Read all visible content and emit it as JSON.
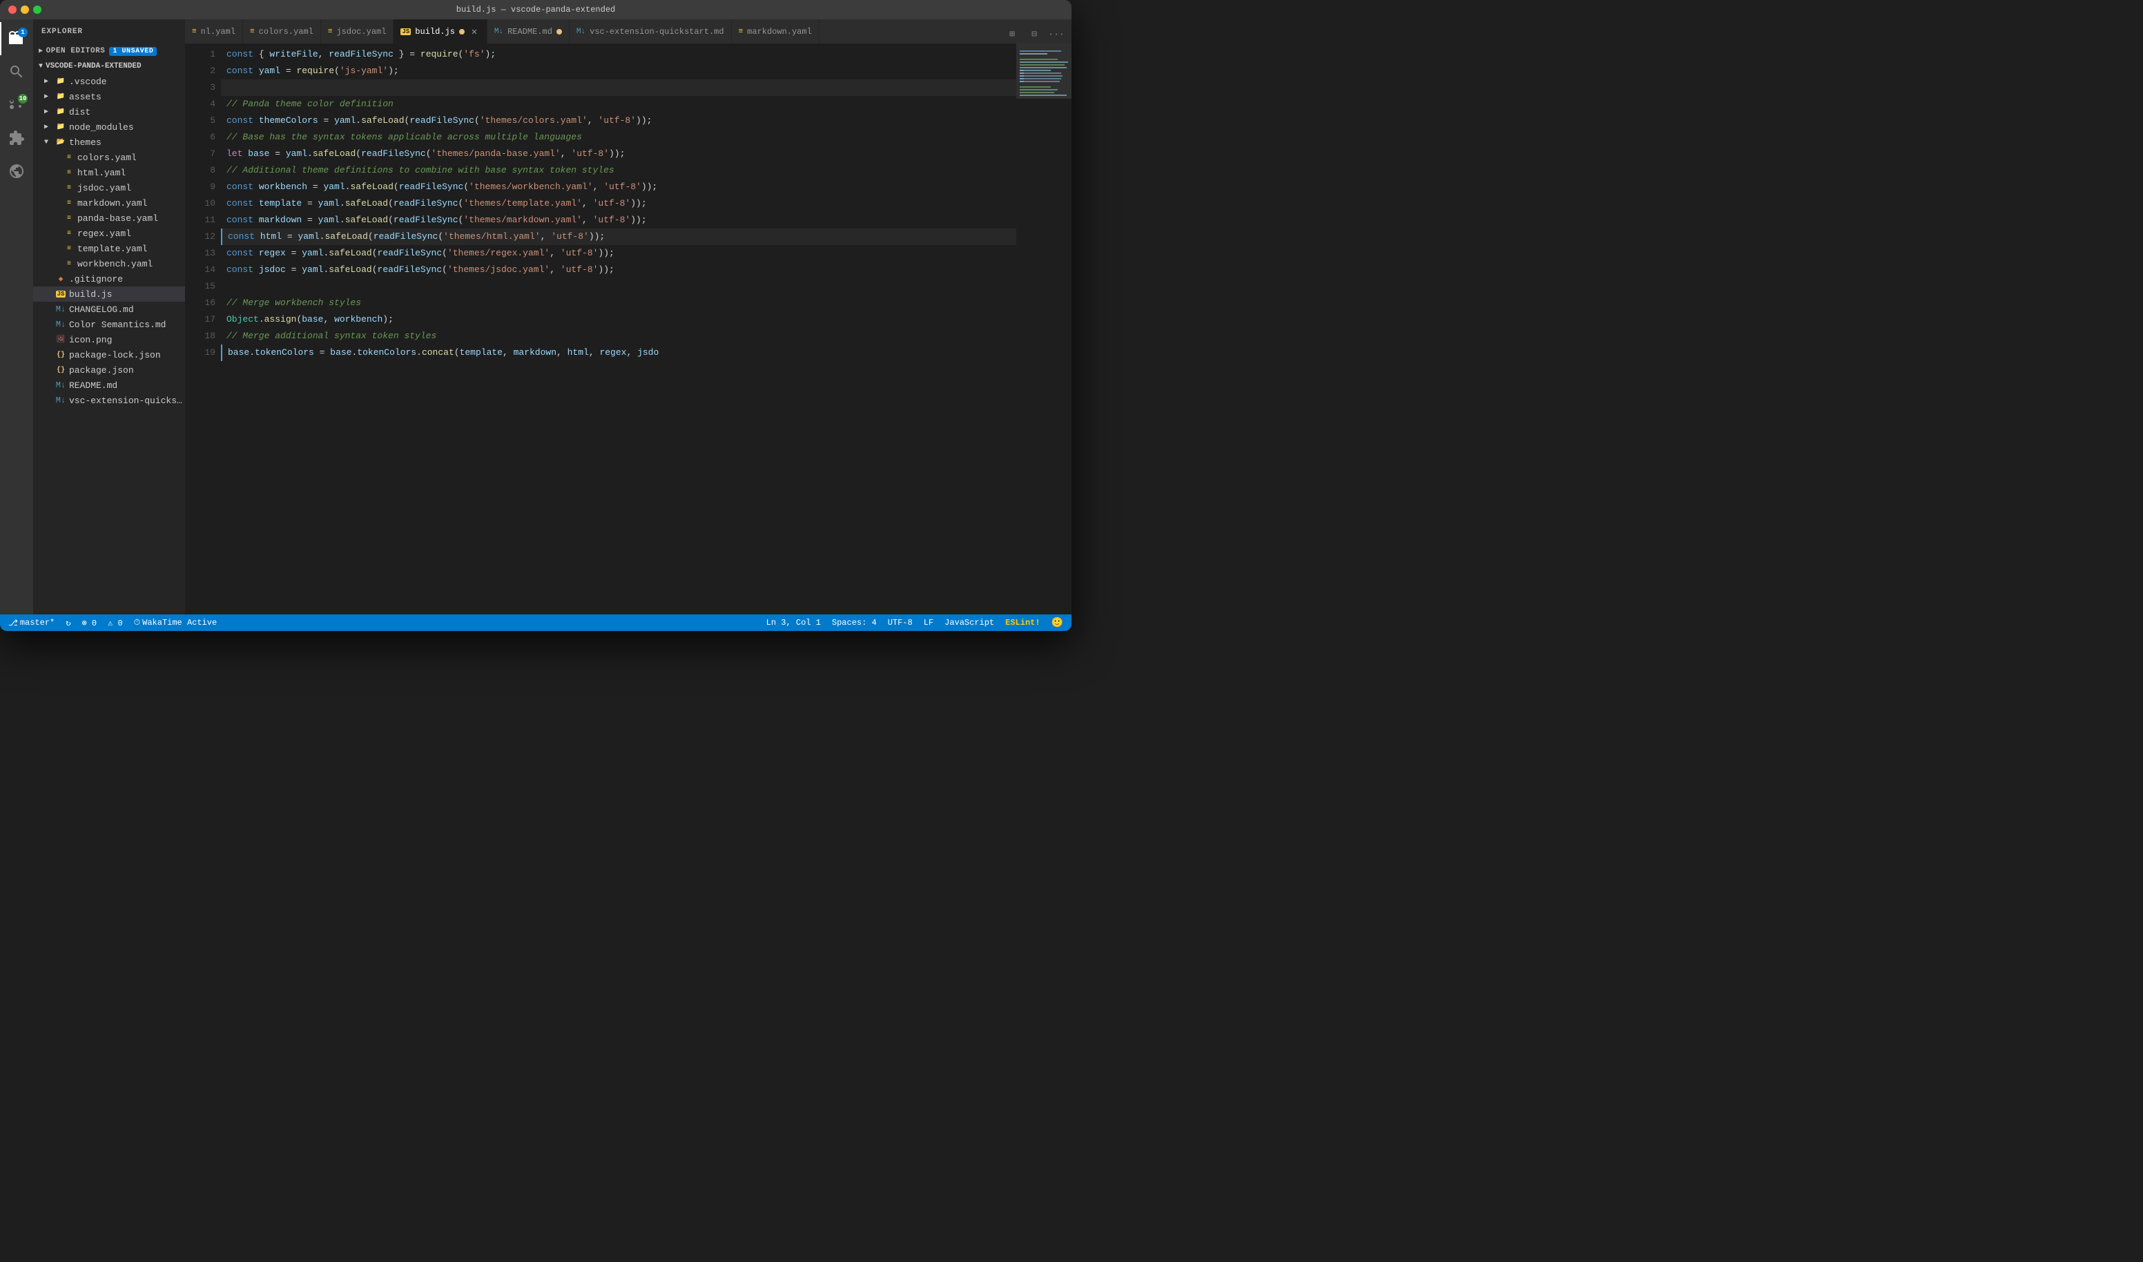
{
  "window": {
    "title": "build.js — vscode-panda-extended"
  },
  "titlebar": {
    "traffic_lights": [
      "close",
      "minimize",
      "maximize"
    ]
  },
  "activity_bar": {
    "icons": [
      {
        "name": "explorer",
        "active": true,
        "badge": "1"
      },
      {
        "name": "search",
        "active": false
      },
      {
        "name": "source-control",
        "active": false,
        "badge": "10"
      },
      {
        "name": "extensions",
        "active": false
      },
      {
        "name": "remote",
        "active": false
      }
    ]
  },
  "sidebar": {
    "header": "Explorer",
    "sections": [
      {
        "label": "Open Editors",
        "badge": "1 Unsaved",
        "collapsed": false
      },
      {
        "label": "VSCODE-PANDA-EXTENDED",
        "collapsed": false
      }
    ],
    "tree": [
      {
        "label": ".vscode",
        "type": "folder",
        "indent": 1,
        "collapsed": true
      },
      {
        "label": "assets",
        "type": "folder",
        "indent": 1,
        "collapsed": true
      },
      {
        "label": "dist",
        "type": "folder",
        "indent": 1,
        "collapsed": true
      },
      {
        "label": "node_modules",
        "type": "folder",
        "indent": 1,
        "collapsed": true
      },
      {
        "label": "themes",
        "type": "folder-open",
        "indent": 1,
        "collapsed": false
      },
      {
        "label": "colors.yaml",
        "type": "yaml",
        "indent": 2
      },
      {
        "label": "html.yaml",
        "type": "yaml",
        "indent": 2
      },
      {
        "label": "jsdoc.yaml",
        "type": "yaml",
        "indent": 2
      },
      {
        "label": "markdown.yaml",
        "type": "yaml",
        "indent": 2
      },
      {
        "label": "panda-base.yaml",
        "type": "yaml",
        "indent": 2
      },
      {
        "label": "regex.yaml",
        "type": "yaml",
        "indent": 2
      },
      {
        "label": "template.yaml",
        "type": "yaml",
        "indent": 2
      },
      {
        "label": "workbench.yaml",
        "type": "yaml",
        "indent": 2
      },
      {
        "label": ".gitignore",
        "type": "git",
        "indent": 1
      },
      {
        "label": "build.js",
        "type": "js",
        "indent": 1,
        "active": true
      },
      {
        "label": "CHANGELOG.md",
        "type": "md",
        "indent": 1
      },
      {
        "label": "Color Semantics.md",
        "type": "md",
        "indent": 1
      },
      {
        "label": "icon.png",
        "type": "png",
        "indent": 1
      },
      {
        "label": "package-lock.json",
        "type": "json",
        "indent": 1
      },
      {
        "label": "package.json",
        "type": "json",
        "indent": 1
      },
      {
        "label": "README.md",
        "type": "md",
        "indent": 1
      },
      {
        "label": "vsc-extension-quickstart.md",
        "type": "md",
        "indent": 1
      }
    ]
  },
  "tabs": [
    {
      "label": "nl.yaml",
      "type": "yaml",
      "active": false,
      "modified": false
    },
    {
      "label": "colors.yaml",
      "type": "yaml",
      "active": false,
      "modified": false
    },
    {
      "label": "jsdoc.yaml",
      "type": "yaml",
      "active": false,
      "modified": false
    },
    {
      "label": "build.js",
      "type": "js",
      "active": true,
      "modified": true
    },
    {
      "label": "README.md",
      "type": "md",
      "active": false,
      "modified": true
    },
    {
      "label": "vsc-extension-quickstart.md",
      "type": "md",
      "active": false,
      "modified": false
    },
    {
      "label": "markdown.yaml",
      "type": "yaml",
      "active": false,
      "modified": false
    }
  ],
  "code_lines": [
    {
      "num": 1,
      "tokens": [
        {
          "t": "kw",
          "v": "const"
        },
        {
          "t": "op",
          "v": " { "
        },
        {
          "t": "var",
          "v": "writeFile"
        },
        {
          "t": "op",
          "v": ", "
        },
        {
          "t": "var",
          "v": "readFileSync"
        },
        {
          "t": "op",
          "v": " } = "
        },
        {
          "t": "fn",
          "v": "require"
        },
        {
          "t": "op",
          "v": "("
        },
        {
          "t": "str",
          "v": "'fs'"
        },
        {
          "t": "op",
          "v": ");"
        }
      ]
    },
    {
      "num": 2,
      "tokens": [
        {
          "t": "kw",
          "v": "const"
        },
        {
          "t": "op",
          "v": " "
        },
        {
          "t": "var",
          "v": "yaml"
        },
        {
          "t": "op",
          "v": " = "
        },
        {
          "t": "fn",
          "v": "require"
        },
        {
          "t": "op",
          "v": "("
        },
        {
          "t": "str",
          "v": "'js-yaml'"
        },
        {
          "t": "op",
          "v": ");"
        }
      ]
    },
    {
      "num": 3,
      "tokens": []
    },
    {
      "num": 4,
      "tokens": [
        {
          "t": "cm",
          "v": "// Panda theme color definition"
        }
      ]
    },
    {
      "num": 5,
      "tokens": [
        {
          "t": "kw",
          "v": "const"
        },
        {
          "t": "op",
          "v": " "
        },
        {
          "t": "var",
          "v": "themeColors"
        },
        {
          "t": "op",
          "v": " = "
        },
        {
          "t": "var",
          "v": "yaml"
        },
        {
          "t": "op",
          "v": "."
        },
        {
          "t": "fn",
          "v": "safeLoad"
        },
        {
          "t": "op",
          "v": "("
        },
        {
          "t": "var",
          "v": "readFileSync"
        },
        {
          "t": "op",
          "v": "("
        },
        {
          "t": "str",
          "v": "'themes/colors.yaml'"
        },
        {
          "t": "op",
          "v": ", "
        },
        {
          "t": "str",
          "v": "'utf-8'"
        },
        {
          "t": "op",
          "v": "));"
        }
      ]
    },
    {
      "num": 6,
      "tokens": [
        {
          "t": "cm",
          "v": "// Base has the syntax tokens applicable across multiple languages"
        }
      ]
    },
    {
      "num": 7,
      "tokens": [
        {
          "t": "kw2",
          "v": "let"
        },
        {
          "t": "op",
          "v": " "
        },
        {
          "t": "var",
          "v": "base"
        },
        {
          "t": "op",
          "v": " = "
        },
        {
          "t": "var",
          "v": "yaml"
        },
        {
          "t": "op",
          "v": "."
        },
        {
          "t": "fn",
          "v": "safeLoad"
        },
        {
          "t": "op",
          "v": "("
        },
        {
          "t": "var",
          "v": "readFileSync"
        },
        {
          "t": "op",
          "v": "("
        },
        {
          "t": "str",
          "v": "'themes/panda-base.yaml'"
        },
        {
          "t": "op",
          "v": ", "
        },
        {
          "t": "str",
          "v": "'utf-8'"
        },
        {
          "t": "op",
          "v": "));"
        }
      ]
    },
    {
      "num": 8,
      "tokens": [
        {
          "t": "cm",
          "v": "// Additional theme definitions to combine with base syntax token styles"
        }
      ]
    },
    {
      "num": 9,
      "tokens": [
        {
          "t": "kw",
          "v": "const"
        },
        {
          "t": "op",
          "v": " "
        },
        {
          "t": "var",
          "v": "workbench"
        },
        {
          "t": "op",
          "v": " = "
        },
        {
          "t": "var",
          "v": "yaml"
        },
        {
          "t": "op",
          "v": "."
        },
        {
          "t": "fn",
          "v": "safeLoad"
        },
        {
          "t": "op",
          "v": "("
        },
        {
          "t": "var",
          "v": "readFileSync"
        },
        {
          "t": "op",
          "v": "("
        },
        {
          "t": "str",
          "v": "'themes/workbench.yaml'"
        },
        {
          "t": "op",
          "v": ", "
        },
        {
          "t": "str",
          "v": "'utf-8'"
        },
        {
          "t": "op",
          "v": "));"
        }
      ]
    },
    {
      "num": 10,
      "tokens": [
        {
          "t": "kw",
          "v": "const"
        },
        {
          "t": "op",
          "v": " "
        },
        {
          "t": "var",
          "v": "template"
        },
        {
          "t": "op",
          "v": " = "
        },
        {
          "t": "var",
          "v": "yaml"
        },
        {
          "t": "op",
          "v": "."
        },
        {
          "t": "fn",
          "v": "safeLoad"
        },
        {
          "t": "op",
          "v": "("
        },
        {
          "t": "var",
          "v": "readFileSync"
        },
        {
          "t": "op",
          "v": "("
        },
        {
          "t": "str",
          "v": "'themes/template.yaml'"
        },
        {
          "t": "op",
          "v": ", "
        },
        {
          "t": "str",
          "v": "'utf-8'"
        },
        {
          "t": "op",
          "v": "));"
        }
      ]
    },
    {
      "num": 11,
      "tokens": [
        {
          "t": "kw",
          "v": "const"
        },
        {
          "t": "op",
          "v": " "
        },
        {
          "t": "var",
          "v": "markdown"
        },
        {
          "t": "op",
          "v": " = "
        },
        {
          "t": "var",
          "v": "yaml"
        },
        {
          "t": "op",
          "v": "."
        },
        {
          "t": "fn",
          "v": "safeLoad"
        },
        {
          "t": "op",
          "v": "("
        },
        {
          "t": "var",
          "v": "readFileSync"
        },
        {
          "t": "op",
          "v": "("
        },
        {
          "t": "str",
          "v": "'themes/markdown.yaml'"
        },
        {
          "t": "op",
          "v": ", "
        },
        {
          "t": "str",
          "v": "'utf-8'"
        },
        {
          "t": "op",
          "v": "));"
        }
      ]
    },
    {
      "num": 12,
      "current": true,
      "tokens": [
        {
          "t": "kw",
          "v": "const"
        },
        {
          "t": "op",
          "v": " "
        },
        {
          "t": "var",
          "v": "html"
        },
        {
          "t": "op",
          "v": " = "
        },
        {
          "t": "var",
          "v": "yaml"
        },
        {
          "t": "op",
          "v": "."
        },
        {
          "t": "fn",
          "v": "safeLoad"
        },
        {
          "t": "op",
          "v": "("
        },
        {
          "t": "var",
          "v": "readFileSync"
        },
        {
          "t": "op",
          "v": "("
        },
        {
          "t": "str",
          "v": "'themes/html.yaml'"
        },
        {
          "t": "op",
          "v": ", "
        },
        {
          "t": "str",
          "v": "'utf-8'"
        },
        {
          "t": "op",
          "v": "));"
        }
      ]
    },
    {
      "num": 13,
      "tokens": [
        {
          "t": "kw",
          "v": "const"
        },
        {
          "t": "op",
          "v": " "
        },
        {
          "t": "var",
          "v": "regex"
        },
        {
          "t": "op",
          "v": " = "
        },
        {
          "t": "var",
          "v": "yaml"
        },
        {
          "t": "op",
          "v": "."
        },
        {
          "t": "fn",
          "v": "safeLoad"
        },
        {
          "t": "op",
          "v": "("
        },
        {
          "t": "var",
          "v": "readFileSync"
        },
        {
          "t": "op",
          "v": "("
        },
        {
          "t": "str",
          "v": "'themes/regex.yaml'"
        },
        {
          "t": "op",
          "v": ", "
        },
        {
          "t": "str",
          "v": "'utf-8'"
        },
        {
          "t": "op",
          "v": "));"
        }
      ]
    },
    {
      "num": 14,
      "tokens": [
        {
          "t": "kw",
          "v": "const"
        },
        {
          "t": "op",
          "v": " "
        },
        {
          "t": "var",
          "v": "jsdoc"
        },
        {
          "t": "op",
          "v": " = "
        },
        {
          "t": "var",
          "v": "yaml"
        },
        {
          "t": "op",
          "v": "."
        },
        {
          "t": "fn",
          "v": "safeLoad"
        },
        {
          "t": "op",
          "v": "("
        },
        {
          "t": "var",
          "v": "readFileSync"
        },
        {
          "t": "op",
          "v": "("
        },
        {
          "t": "str",
          "v": "'themes/jsdoc.yaml'"
        },
        {
          "t": "op",
          "v": ", "
        },
        {
          "t": "str",
          "v": "'utf-8'"
        },
        {
          "t": "op",
          "v": "));"
        }
      ]
    },
    {
      "num": 15,
      "tokens": []
    },
    {
      "num": 16,
      "tokens": [
        {
          "t": "cm",
          "v": "// Merge workbench styles"
        }
      ]
    },
    {
      "num": 17,
      "tokens": [
        {
          "t": "obj",
          "v": "Object"
        },
        {
          "t": "op",
          "v": "."
        },
        {
          "t": "fn",
          "v": "assign"
        },
        {
          "t": "op",
          "v": "("
        },
        {
          "t": "var",
          "v": "base"
        },
        {
          "t": "op",
          "v": ", "
        },
        {
          "t": "var",
          "v": "workbench"
        },
        {
          "t": "op",
          "v": ");"
        }
      ]
    },
    {
      "num": 18,
      "tokens": [
        {
          "t": "cm",
          "v": "// Merge additional syntax token styles"
        }
      ]
    },
    {
      "num": 19,
      "current_line_indicator": true,
      "tokens": [
        {
          "t": "var",
          "v": "base"
        },
        {
          "t": "op",
          "v": "."
        },
        {
          "t": "prop",
          "v": "tokenColors"
        },
        {
          "t": "op",
          "v": " = "
        },
        {
          "t": "var",
          "v": "base"
        },
        {
          "t": "op",
          "v": "."
        },
        {
          "t": "prop",
          "v": "tokenColors"
        },
        {
          "t": "op",
          "v": "."
        },
        {
          "t": "fn",
          "v": "concat"
        },
        {
          "t": "op",
          "v": "("
        },
        {
          "t": "var",
          "v": "template"
        },
        {
          "t": "op",
          "v": ", "
        },
        {
          "t": "var",
          "v": "markdown"
        },
        {
          "t": "op",
          "v": ", "
        },
        {
          "t": "var",
          "v": "html"
        },
        {
          "t": "op",
          "v": ", "
        },
        {
          "t": "var",
          "v": "regex"
        },
        {
          "t": "op",
          "v": ", "
        },
        {
          "t": "var",
          "v": "jsdo"
        }
      ]
    }
  ],
  "status_bar": {
    "branch": "master*",
    "sync": "↻",
    "errors": "⊗ 0",
    "warnings": "⚠ 0",
    "wakatime": "WakaTime Active",
    "position": "Ln 3, Col 1",
    "spaces": "Spaces: 4",
    "encoding": "UTF-8",
    "line_ending": "LF",
    "language": "JavaScript",
    "eslint": "ESLint!",
    "smiley": "🙂"
  }
}
